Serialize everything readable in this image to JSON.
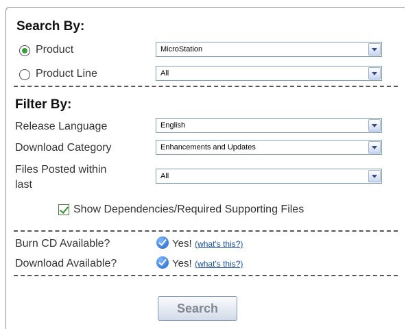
{
  "search_by": {
    "heading": "Search By:",
    "product": {
      "label": "Product",
      "selected": true,
      "value": "MicroStation"
    },
    "product_line": {
      "label": "Product Line",
      "selected": false,
      "value": "All"
    }
  },
  "filter_by": {
    "heading": "Filter By:",
    "release_language": {
      "label": "Release Language",
      "value": "English"
    },
    "download_category": {
      "label": "Download Category",
      "value": "Enhancements and Updates"
    },
    "files_posted": {
      "label_line1": "Files Posted within",
      "label_line2": "last",
      "value": "All"
    },
    "show_dependencies": {
      "label": "Show Dependencies/Required Supporting Files",
      "checked": true
    }
  },
  "availability": {
    "burn_cd": {
      "label": "Burn CD Available?",
      "status": "Yes!",
      "link": "(what's this?)"
    },
    "download": {
      "label": "Download Available?",
      "status": "Yes!",
      "link": "(what's this?)"
    }
  },
  "search_button": "Search",
  "colors": {
    "accent_green": "#3a9c3a",
    "badge_blue": "#1f63c8",
    "link": "#1a4fa0"
  }
}
